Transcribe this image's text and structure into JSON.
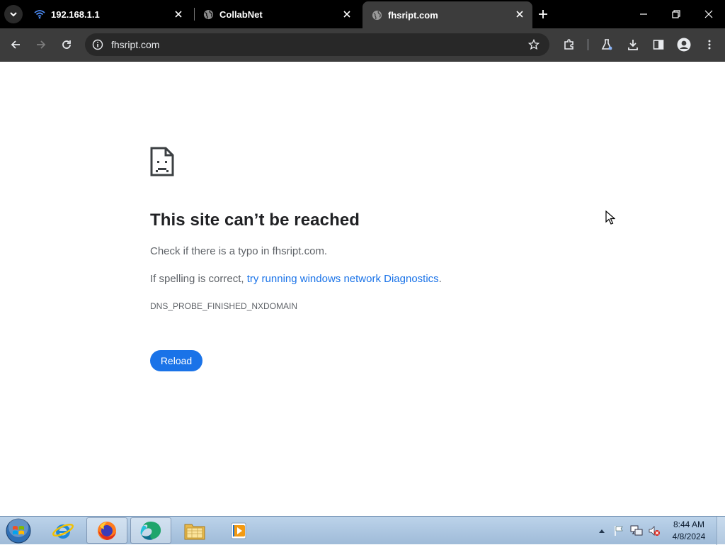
{
  "browser": {
    "tabs": [
      {
        "label": "192.168.1.1",
        "favicon": "wifi-icon",
        "active": false
      },
      {
        "label": "CollabNet",
        "favicon": "globe-icon",
        "active": false
      },
      {
        "label": "fhsript.com",
        "favicon": "globe-icon",
        "active": true
      }
    ],
    "address": "fhsript.com",
    "colors": {
      "frame": "#000000",
      "toolbar": "#3c3c3c",
      "omnibox": "#282828"
    }
  },
  "error_page": {
    "title": "This site can’t be reached",
    "line1": "Check if there is a typo in fhsript.com.",
    "line2_prefix": "If spelling is correct, ",
    "line2_link": "try running windows network Diagnostics",
    "line2_suffix": ".",
    "error_code": "DNS_PROBE_FINISHED_NXDOMAIN",
    "reload_label": "Reload",
    "colors": {
      "accent": "#1a73e8",
      "title": "#202124",
      "body": "#5f6368"
    }
  },
  "taskbar": {
    "apps": [
      "internet-explorer-icon",
      "firefox-icon",
      "browser-app-icon",
      "file-explorer-icon",
      "media-player-icon"
    ],
    "active_app": "browser-app-icon",
    "clock": {
      "time": "8:44 AM",
      "date": "4/8/2024"
    }
  }
}
